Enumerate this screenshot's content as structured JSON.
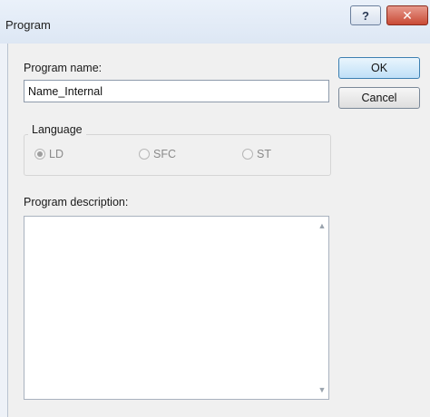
{
  "window": {
    "title": "Program"
  },
  "titlebar": {
    "help_glyph": "?",
    "close_glyph": "✕"
  },
  "form": {
    "program_name_label": "Program name:",
    "program_name_value": "Name_Internal",
    "language_label": "Language",
    "languages": [
      {
        "label": "LD",
        "checked": true
      },
      {
        "label": "SFC",
        "checked": false
      },
      {
        "label": "ST",
        "checked": false
      }
    ],
    "description_label": "Program description:",
    "description_value": ""
  },
  "buttons": {
    "ok": "OK",
    "cancel": "Cancel"
  },
  "scrollbar": {
    "up_glyph": "▲",
    "down_glyph": "▼"
  }
}
